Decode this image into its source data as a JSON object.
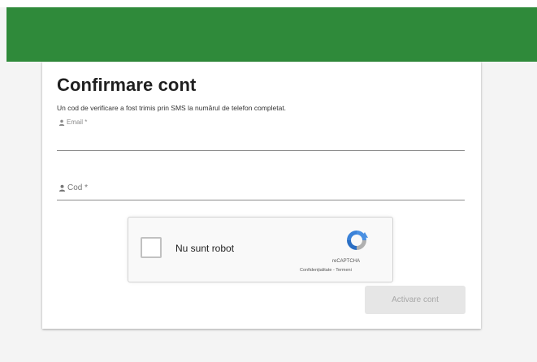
{
  "header": {
    "color": "#2f8a3a"
  },
  "form": {
    "title": "Confirmare cont",
    "subtitle": "Un cod de verificare a fost trimis prin SMS la numărul de telefon completat.",
    "email_label": "Email *",
    "email_value": "",
    "code_label": "Cod *",
    "code_value": "",
    "field_icon": "person-icon"
  },
  "captcha": {
    "label": "Nu sunt robot",
    "checked": false,
    "brand": "reCAPTCHA",
    "privacy_link": "Confidențialitate",
    "separator": "-",
    "terms_link": "Termeni",
    "logo_icon": "recaptcha-logo-icon"
  },
  "actions": {
    "activate_label": "Activare cont",
    "activate_disabled": true
  }
}
